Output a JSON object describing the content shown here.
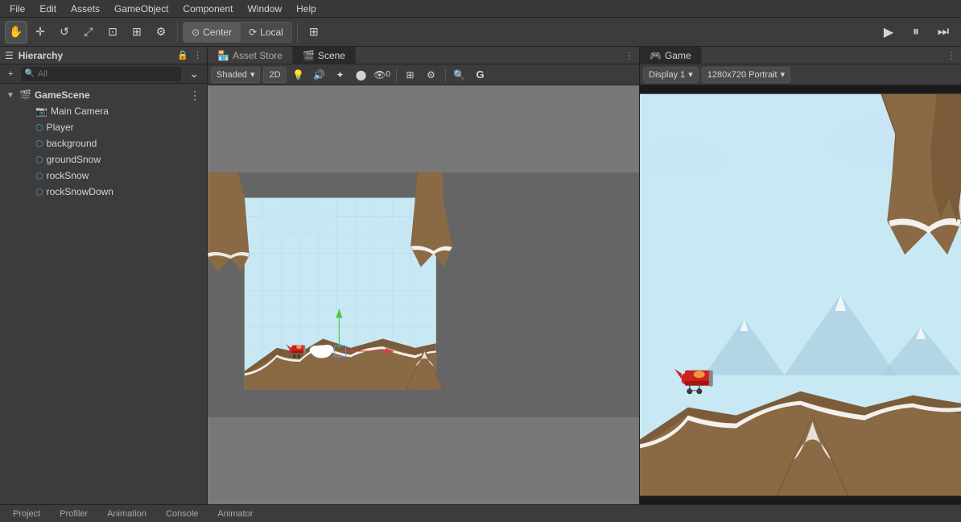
{
  "menubar": {
    "items": [
      "File",
      "Edit",
      "Assets",
      "GameObject",
      "Component",
      "Window",
      "Help"
    ]
  },
  "toolbar": {
    "tools": [
      "✋",
      "✛",
      "↺",
      "⤢",
      "⊡",
      "🌐",
      "⚙"
    ],
    "transform_center": "Center",
    "transform_local": "Local",
    "grid_icon": "⊞",
    "play": "▶",
    "pause": "⏸",
    "step": "⏭"
  },
  "hierarchy": {
    "title": "Hierarchy",
    "search_placeholder": "All",
    "items": [
      {
        "label": "GameScene",
        "indent": 0,
        "is_root": true,
        "icon": "scene"
      },
      {
        "label": "Main Camera",
        "indent": 1,
        "icon": "camera"
      },
      {
        "label": "Player",
        "indent": 1,
        "icon": "cube"
      },
      {
        "label": "background",
        "indent": 1,
        "icon": "cube"
      },
      {
        "label": "groundSnow",
        "indent": 1,
        "icon": "cube"
      },
      {
        "label": "rockSnow",
        "indent": 1,
        "icon": "cube"
      },
      {
        "label": "rockSnowDown",
        "indent": 1,
        "icon": "cube"
      }
    ]
  },
  "asset_store": {
    "title": "Asset Store",
    "icon": "store"
  },
  "scene": {
    "title": "Scene",
    "icon": "scene",
    "toolbar": {
      "shading": "Shaded",
      "mode_2d": "2D",
      "buttons": [
        "💡",
        "🔊",
        "🌀",
        "👁",
        "0",
        "⊞",
        "⚙",
        "🌐",
        "G"
      ]
    }
  },
  "game": {
    "title": "Game",
    "icon": "game",
    "display": "Display 1",
    "resolution": "1280x720 Portrait",
    "dropdown_arrow": "▾"
  },
  "bottom_tabs": [
    "Project",
    "Profiler",
    "Animation",
    "Console",
    "Animator"
  ]
}
